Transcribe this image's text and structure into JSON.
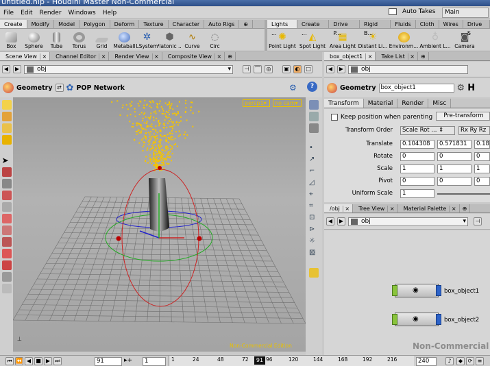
{
  "title": "untitled.hip - Houdini Master Non-Commercial",
  "menu": [
    "File",
    "Edit",
    "Render",
    "Windows",
    "Help"
  ],
  "auto_takes": "Auto Takes",
  "main_select": "Main",
  "shelf_left": {
    "tabs": [
      "Create",
      "Modify",
      "Model",
      "Polygon",
      "Deform",
      "Texture",
      "Character",
      "Auto Rigs"
    ],
    "tools": [
      {
        "label": "Box",
        "icon": "box-icon"
      },
      {
        "label": "Sphere",
        "icon": "sphere-icon"
      },
      {
        "label": "Tube",
        "icon": "tube-icon"
      },
      {
        "label": "Torus",
        "icon": "torus-icon"
      },
      {
        "label": "Grid",
        "icon": "grid-icon"
      },
      {
        "label": "Metaball",
        "icon": "metaball-icon"
      },
      {
        "label": "LSystem",
        "icon": "lsystem-icon"
      },
      {
        "label": "Platonic ...",
        "icon": "platonic-icon"
      },
      {
        "label": "Curve",
        "icon": "curve-icon"
      },
      {
        "label": "Circ",
        "icon": "circle-icon"
      }
    ]
  },
  "shelf_right": {
    "tabs": [
      "Lights ...",
      "Create ...",
      "Drive P...",
      "Rigid B...",
      "Fluids",
      "Cloth",
      "Wires",
      "Drive S"
    ],
    "tools": [
      {
        "label": "Point Light",
        "icon": "point-light-icon"
      },
      {
        "label": "Spot Light",
        "icon": "spot-light-icon"
      },
      {
        "label": "Area Light",
        "icon": "area-light-icon"
      },
      {
        "label": "Distant Li...",
        "icon": "distant-light-icon"
      },
      {
        "label": "Environm...",
        "icon": "environment-light-icon"
      },
      {
        "label": "Ambient L...",
        "icon": "ambient-light-icon"
      },
      {
        "label": "Camera",
        "icon": "camera-icon"
      }
    ]
  },
  "left_pane": {
    "tabs": [
      "Scene View",
      "Channel Editor",
      "Render View",
      "Composite View"
    ],
    "path": "obj",
    "context_geometry": "Geometry",
    "context_network": "POP Network",
    "persp": "persp1",
    "cam": "no cam",
    "watermark": "Non-Commercial Edition"
  },
  "params": {
    "tabs_top": [
      "box_object1",
      "Take List"
    ],
    "path": "obj",
    "type": "Geometry",
    "name": "box_object1",
    "help": "H",
    "tabs": [
      "Transform",
      "Material",
      "Render",
      "Misc"
    ],
    "keep_position": "Keep position when parenting",
    "pretransform": "Pre-transform",
    "transform_order_label": "Transform Order",
    "transform_order": "Scale Rot ...",
    "rot_order": "Rx Ry Rz",
    "rows": [
      {
        "label": "Translate",
        "values": [
          "0.104308",
          "0.571831",
          "0.18"
        ]
      },
      {
        "label": "Rotate",
        "values": [
          "0",
          "0",
          "0"
        ]
      },
      {
        "label": "Scale",
        "values": [
          "1",
          "1",
          "1"
        ]
      },
      {
        "label": "Pivot",
        "values": [
          "0",
          "0",
          "0"
        ]
      }
    ],
    "uniform_scale_label": "Uniform Scale",
    "uniform_scale": "1"
  },
  "network": {
    "tabs": [
      "/obj",
      "Tree View",
      "Material Palette"
    ],
    "path": "obj",
    "nodes": [
      "box_object1",
      "box_object2"
    ],
    "watermark": "Non-Commercial E"
  },
  "timeline": {
    "frame": "91",
    "start": "1",
    "end": "240",
    "current": "91",
    "ticks": [
      "1",
      "24",
      "48",
      "72",
      "96",
      "120",
      "144",
      "168",
      "192",
      "216"
    ]
  },
  "colors": {
    "particles": "#f5c400",
    "node_left": "#8ac43c",
    "node_right": "#2d63c8",
    "watermark": "#e8c000"
  }
}
